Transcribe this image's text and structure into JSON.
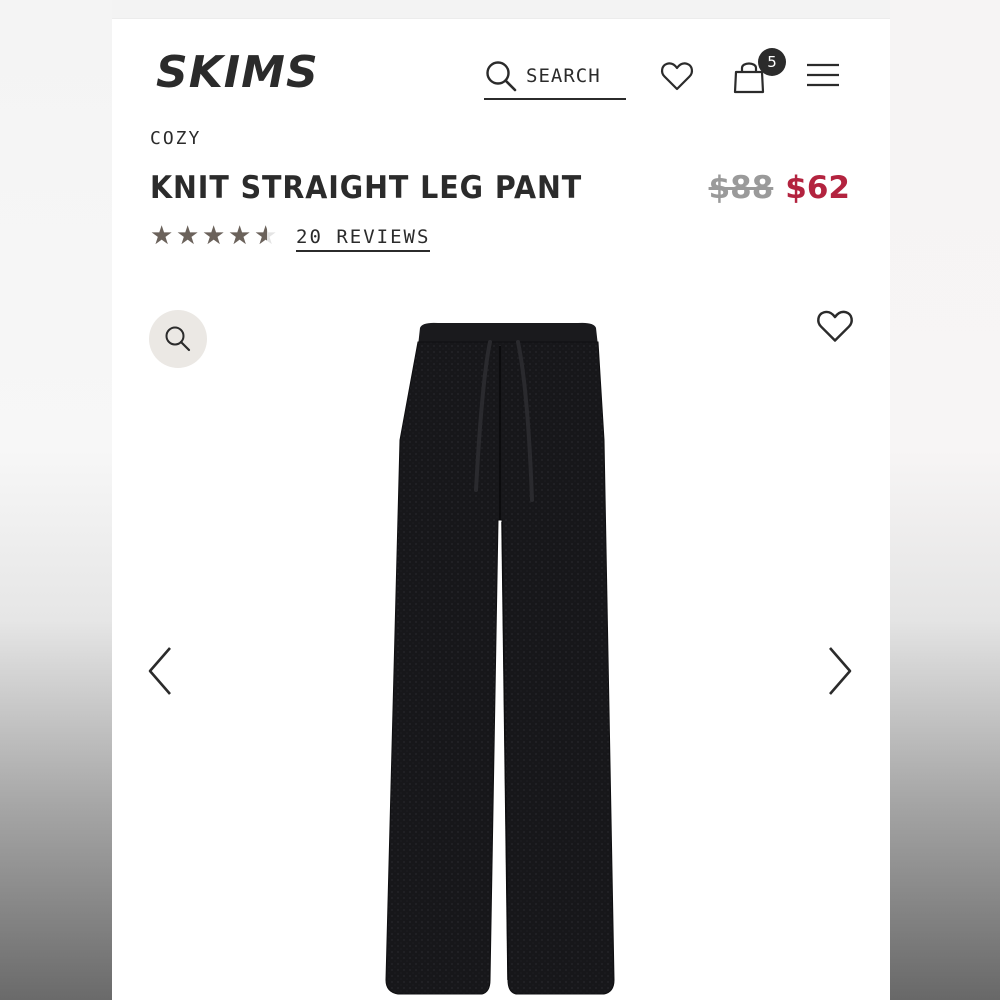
{
  "header": {
    "brand": "SKIMS",
    "search_label": "SEARCH",
    "cart_count": "5"
  },
  "product": {
    "category": "COZY",
    "title": "KNIT STRAIGHT LEG PANT",
    "price_original": "$88",
    "price_sale": "$62",
    "rating": 4.5,
    "rating_max": 5,
    "reviews_label": "20 REVIEWS"
  },
  "icons": {
    "search": "search-icon",
    "wishlist": "heart-icon",
    "cart": "shopping-bag-icon",
    "menu": "hamburger-menu-icon",
    "zoom": "zoom-icon",
    "prev": "chevron-left-icon",
    "next": "chevron-right-icon"
  },
  "colors": {
    "text": "#2b2b2b",
    "sale": "#b3233f",
    "strike": "#9a9a9a",
    "star": "#6b625b",
    "zoom_bg": "#ebe8e4"
  }
}
